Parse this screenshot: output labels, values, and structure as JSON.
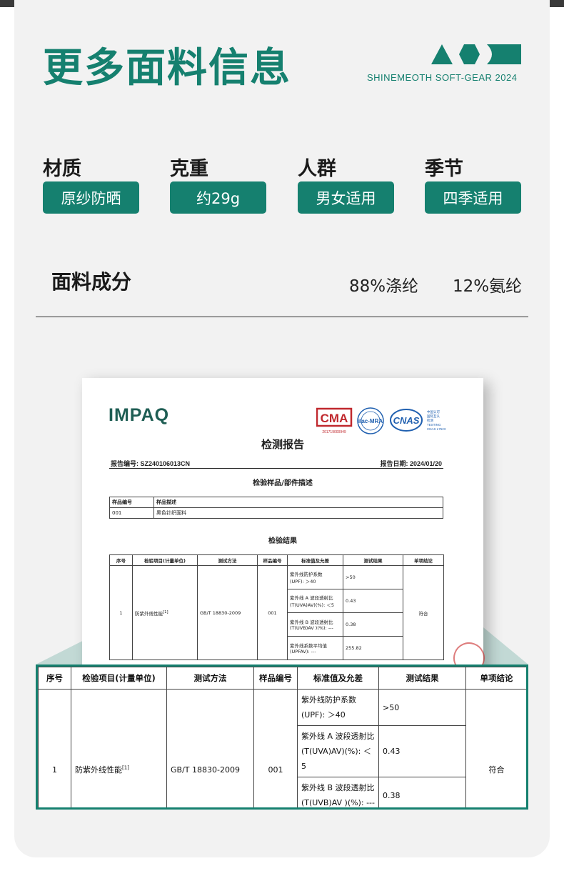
{
  "header": {
    "title": "更多面料信息",
    "brand_line": "SHINEMEOTH  SOFT-GEAR  2024"
  },
  "specs": [
    {
      "label": "材质",
      "value": "原纱防晒"
    },
    {
      "label": "克重",
      "value": "约29g"
    },
    {
      "label": "人群",
      "value": "男女适用"
    },
    {
      "label": "季节",
      "value": "四季适用"
    }
  ],
  "composition": {
    "label": "面料成分",
    "values": [
      "88%涤纶",
      "12%氨纶"
    ]
  },
  "report": {
    "logo": "IMPAQ",
    "cert_marks": [
      "CMA",
      "ilac-MRA",
      "CNAS"
    ],
    "cma_number": "201719000949",
    "cnas_text": [
      "中国认可",
      "国际互认",
      "检测",
      "TESTING",
      "CNAS L7523"
    ],
    "title": "检测报告",
    "report_no": "报告编号: SZ240106013CN",
    "report_date": "报告日期: 2024/01/20",
    "sample_section": "检验样品/部件描述",
    "sample_headers": [
      "样品编号",
      "样品描述"
    ],
    "sample_row": [
      "001",
      "黑色针织面料"
    ],
    "result_section": "检验结果",
    "result_headers": [
      "序号",
      "检验项目(计量单位)",
      "测试方法",
      "样品编号",
      "标准值及允差",
      "测试结果",
      "单项结论"
    ],
    "row": {
      "no": "1",
      "item": "防紫外线性能",
      "item_sup": "[1]",
      "method": "GB/T 18830-2009",
      "sample": "001",
      "conclusion": "符合",
      "sub": [
        {
          "standard_a": "紫外线防护系数",
          "standard_b": "(UPF): ＞40",
          "result": ">50"
        },
        {
          "standard_a": "紫外线 A 波段透射比",
          "standard_b": "(T(UVA)AV)(%): ＜5",
          "result": "0.43"
        },
        {
          "standard_a": "紫外线 B 波段透射比",
          "standard_b": "(T(UVB)AV )(%): ---",
          "result": "0.38"
        },
        {
          "standard_a": "紫外线系数平均值",
          "standard_b": "(UPFAV): ---",
          "result": "255.82"
        }
      ]
    }
  },
  "colors": {
    "accent": "#15806f",
    "background": "#f2f2f2",
    "pill_text": "#ffffff"
  }
}
